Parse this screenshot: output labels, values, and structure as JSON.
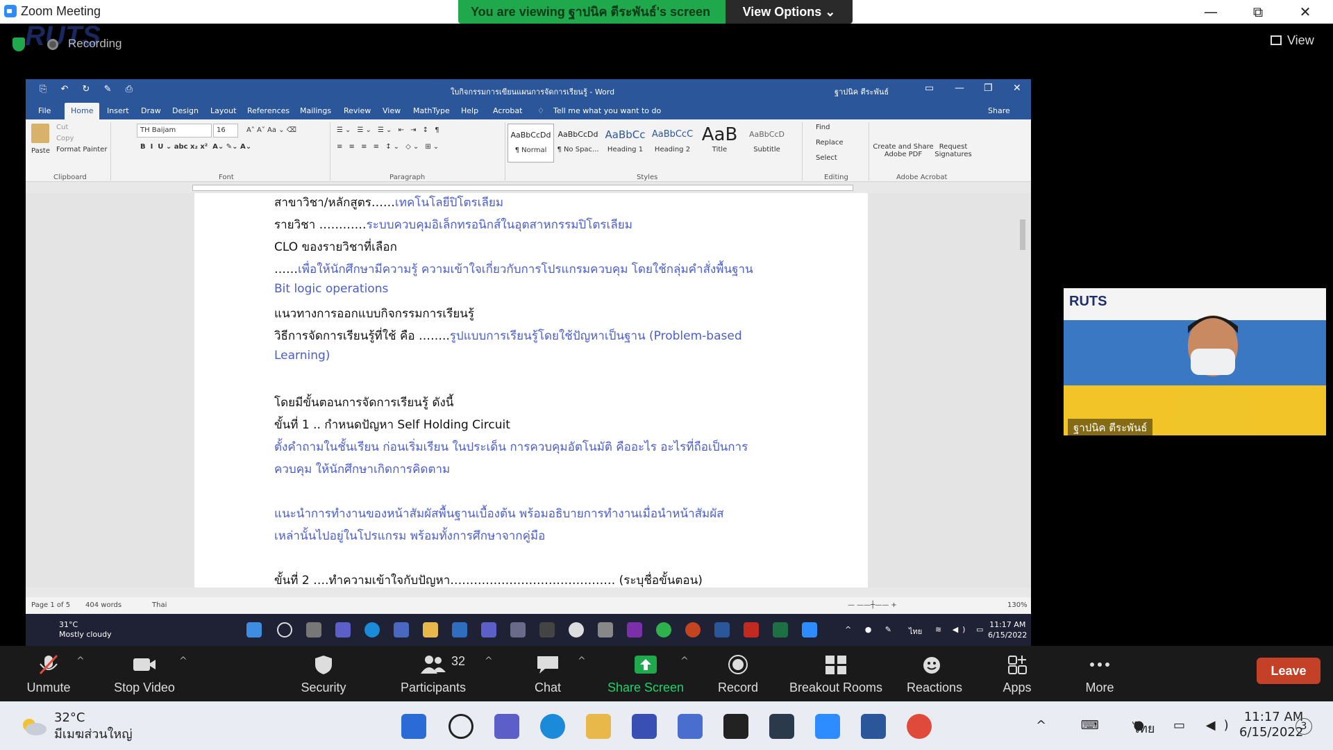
{
  "zoom": {
    "app_title": "Zoom Meeting",
    "share_banner": "You are viewing ฐาปนิค ตีระพันธ์'s screen",
    "view_options": "View Options ⌄",
    "recording": "Recording",
    "view_label": "View",
    "controls": {
      "minimize": "—",
      "maximize": "⧉",
      "close": "✕"
    }
  },
  "word": {
    "doc_title": "ใบกิจกรรมการเขียนแผนการจัดการเรียนรู้ - Word",
    "user": "ฐาปนิค ตีระพันธ์",
    "menu": [
      "File",
      "Home",
      "Insert",
      "Draw",
      "Design",
      "Layout",
      "References",
      "Mailings",
      "Review",
      "View",
      "MathType",
      "Help",
      "Acrobat"
    ],
    "tell_me": "Tell me what you want to do",
    "share": "Share",
    "clipboard": {
      "paste": "Paste",
      "cut": "Cut",
      "copy": "Copy",
      "format_painter": "Format Painter",
      "label": "Clipboard"
    },
    "font": {
      "name": "TH Baijam",
      "size": "16",
      "label": "Font"
    },
    "paragraph_label": "Paragraph",
    "styles": [
      {
        "preview": "AaBbCcDd",
        "name": "¶ Normal"
      },
      {
        "preview": "AaBbCcDd",
        "name": "¶ No Spac..."
      },
      {
        "preview": "AaBbCc",
        "name": "Heading 1"
      },
      {
        "preview": "AaBbCcC",
        "name": "Heading 2"
      },
      {
        "preview": "AaB",
        "name": "Title"
      },
      {
        "preview": "AaBbCcD",
        "name": "Subtitle"
      }
    ],
    "styles_label": "Styles",
    "editing": {
      "find": "Find",
      "replace": "Replace",
      "select": "Select",
      "label": "Editing"
    },
    "acrobat": {
      "create": "Create and Share Adobe PDF",
      "request": "Request Signatures",
      "label": "Adobe Acrobat"
    },
    "doc_lines": [
      {
        "text": "สาขาวิชา/หลักสูตร……",
        "blue": "เทคโนโลยีปิโตรเลียม"
      },
      {
        "text": "รายวิชา …………",
        "blue": "ระบบควบคุมอิเล็กทรอนิกส์ในอุตสาหกรรมปิโตรเลียม"
      },
      {
        "text": "CLO ของรายวิชาที่เลือก",
        "blue": ""
      },
      {
        "text": "……",
        "blue": "เพื่อให้นักศึกษามีความรู้ ความเข้าใจเกี่ยวกับการโปรแกรมควบคุม โดยใช้กลุ่มคำสั่งพื้นฐาน"
      },
      {
        "text": "",
        "blue": "Bit logic operations"
      },
      {
        "text": "แนวทางการออกแบบกิจกรรมการเรียนรู้",
        "blue": ""
      },
      {
        "text": "วิธีการจัดการเรียนรู้ที่ใช้ คือ ……..",
        "blue": "รูปแบบการเรียนรู้โดยใช้ปัญหาเป็นฐาน (Problem-based"
      },
      {
        "text": "",
        "blue": "Learning)"
      },
      {
        "text": "โดยมีขั้นตอนการจัดการเรียนรู้ ดังนี้",
        "blue": ""
      },
      {
        "text": "ขั้นที่ 1 .. กำหนดปัญหา Self Holding Circuit",
        "blue": ""
      },
      {
        "text": "",
        "blue": "ตั้งคำถามในชั้นเรียน ก่อนเริ่มเรียน ในประเด็น การควบคุมอัตโนมัติ คืออะไร อะไรที่ถือเป็นการ"
      },
      {
        "text": "",
        "blue": "ควบคุม ให้นักศึกษาเกิดการคิดตาม"
      },
      {
        "text": "",
        "blue": "แนะนำการทำงานของหน้าสัมผัสพื้นฐานเบื้องต้น พร้อมอธิบายการทำงานเมื่อนำหน้าสัมผัส"
      },
      {
        "text": "",
        "blue": "เหล่านั้นไปอยู่ในโปรแกรม พร้อมทั้งการศึกษาจากคู่มือ"
      },
      {
        "text": "ขั้นที่ 2 ….ทำความเข้าใจกับปัญหา…………………………………… (ระบุชื่อขั้นตอน)",
        "blue": ""
      }
    ],
    "status": {
      "page": "Page 1 of 5",
      "words": "404 words",
      "lang": "Thai",
      "zoom": "130%"
    }
  },
  "inner_taskbar": {
    "temp": "31°C",
    "weather": "Mostly cloudy",
    "lang": "ไทย",
    "time": "11:17 AM",
    "date": "6/15/2022"
  },
  "participant": {
    "name": "ฐาปนิค ตีระพันธ์",
    "banner": "RUTS"
  },
  "toolbar": {
    "unmute": "Unmute",
    "stop_video": "Stop Video",
    "security": "Security",
    "participants": "Participants",
    "participants_count": "32",
    "chat": "Chat",
    "share_screen": "Share Screen",
    "record": "Record",
    "breakout": "Breakout Rooms",
    "reactions": "Reactions",
    "apps": "Apps",
    "more": "More",
    "leave": "Leave"
  },
  "outer_taskbar": {
    "temp": "32°C",
    "weather": "มีเมฆส่วนใหญ่",
    "lang": "ไทย",
    "time": "11:17 AM",
    "date": "6/15/2022",
    "notif": "3"
  },
  "colors": {
    "word_blue": "#2b579a",
    "share_green": "#1fa84c",
    "leave_red": "#c44026",
    "doc_blue": "#4a5dd0"
  }
}
